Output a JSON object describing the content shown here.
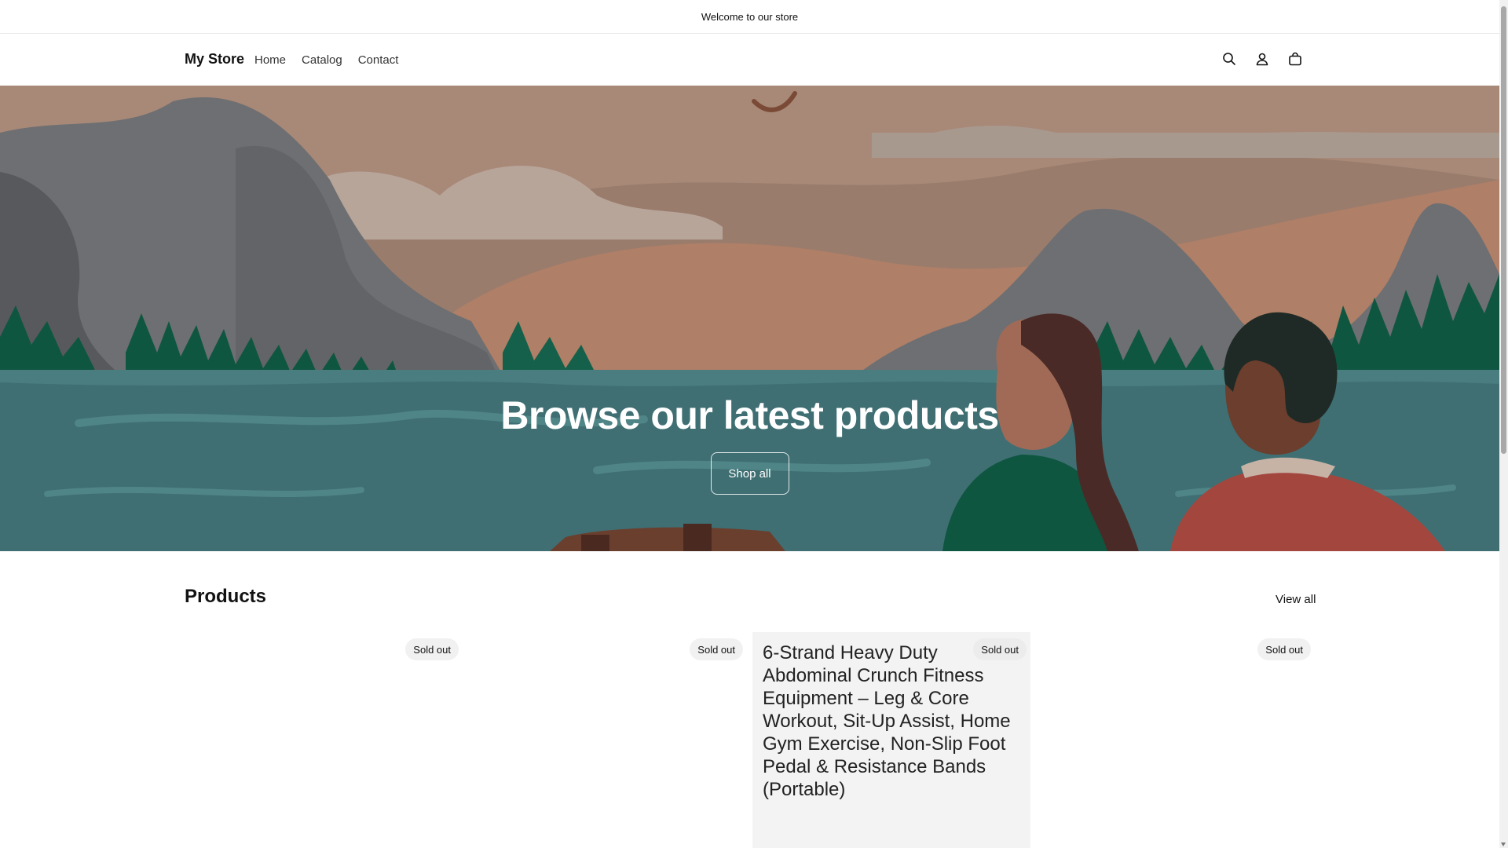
{
  "announcement": {
    "text": "Welcome to our store"
  },
  "header": {
    "logo": "My Store",
    "nav": [
      "Home",
      "Catalog",
      "Contact"
    ],
    "icons": [
      "search-icon",
      "account-icon",
      "cart-icon"
    ]
  },
  "hero": {
    "title": "Browse our latest products",
    "button": "Shop all"
  },
  "products": {
    "title": "Products",
    "view_all": "View all",
    "cards": [
      {
        "badge": "Sold out",
        "title": ""
      },
      {
        "badge": "Sold out",
        "title": ""
      },
      {
        "badge": "Sold out",
        "title": "6-Strand Heavy Duty Abdominal Crunch Fitness Equipment – Leg & Core Workout, Sit-Up Assist, Home Gym Exercise, Non-Slip Foot Pedal & Resistance Bands (Portable)"
      },
      {
        "badge": "Sold out",
        "title": ""
      }
    ]
  },
  "colors": {
    "hero_sky": "#9a7c6c",
    "hero_water": "#3f6f73",
    "forest": "#0f5640"
  }
}
